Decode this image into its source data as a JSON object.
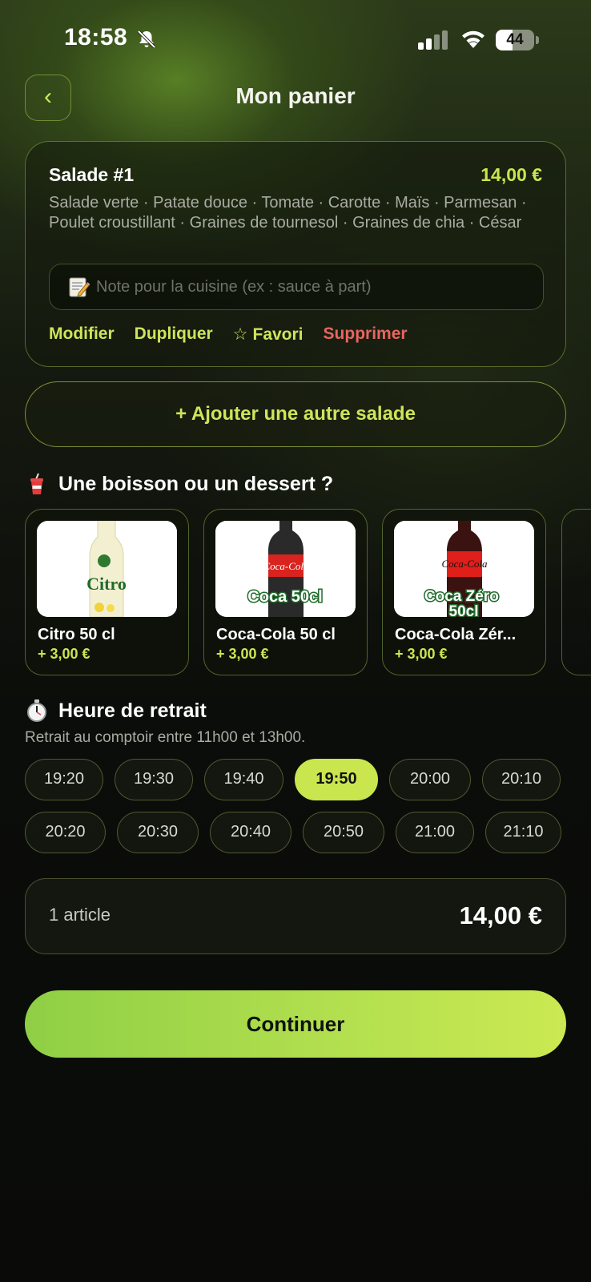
{
  "status_bar": {
    "time": "18:58",
    "battery_level": "44",
    "battery_fraction": 0.44
  },
  "header": {
    "back_label": "‹",
    "title": "Mon panier"
  },
  "cart_item": {
    "name": "Salade #1",
    "price": "14,00 €",
    "ingredients": "Salade verte · Patate douce · Tomate · Carotte · Maïs · Parmesan · Poulet croustillant · Graines de tournesol · Graines de chia · César",
    "note_placeholder": "Note pour la cuisine (ex : sauce à part)",
    "actions": {
      "edit": "Modifier",
      "duplicate": "Dupliquer",
      "favorite": "Favori",
      "delete": "Supprimer"
    }
  },
  "add_salad_label": "+ Ajouter une autre salade",
  "extras": {
    "title": "Une boisson ou un dessert ?",
    "items": [
      {
        "name": "Citro 50 cl",
        "price": "+ 3,00 €",
        "image_text": "Citro"
      },
      {
        "name": "Coca-Cola 50 cl",
        "price": "+ 3,00 €",
        "image_text": "Coca 50cl"
      },
      {
        "name": "Coca-Cola Zér...",
        "price": "+ 3,00 €",
        "image_text": "Coca Zéro 50cl"
      }
    ]
  },
  "pickup": {
    "title": "Heure de retrait",
    "subtitle": "Retrait au comptoir entre 11h00 et 13h00.",
    "selected": "19:50",
    "row1": [
      "19:20",
      "19:30",
      "19:40",
      "19:50",
      "20:00",
      "20:10"
    ],
    "row2": [
      "20:20",
      "20:30",
      "20:40",
      "20:50",
      "21:00",
      "21:10"
    ]
  },
  "summary": {
    "count": "1 article",
    "total": "14,00 €"
  },
  "continue_label": "Continuer",
  "colors": {
    "accent": "#c9e64f",
    "danger": "#e86560",
    "background": "#0b0d0a"
  }
}
